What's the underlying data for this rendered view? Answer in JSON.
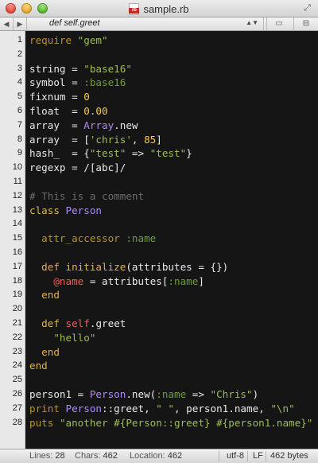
{
  "window": {
    "title": "sample.rb",
    "file_badge": "rb"
  },
  "symbol_bar": {
    "current_symbol": "def self.greet"
  },
  "editor": {
    "lines": [
      {
        "n": "1",
        "tokens": [
          [
            "req",
            "require"
          ],
          [
            "plain",
            " "
          ],
          [
            "str",
            "\"gem\""
          ]
        ]
      },
      {
        "n": "2",
        "tokens": []
      },
      {
        "n": "3",
        "tokens": [
          [
            "plain",
            "string = "
          ],
          [
            "str",
            "\"base16\""
          ]
        ]
      },
      {
        "n": "4",
        "tokens": [
          [
            "plain",
            "symbol = "
          ],
          [
            "sym",
            ":base16"
          ]
        ]
      },
      {
        "n": "5",
        "tokens": [
          [
            "plain",
            "fixnum = "
          ],
          [
            "num",
            "0"
          ]
        ]
      },
      {
        "n": "6",
        "tokens": [
          [
            "plain",
            "float  = "
          ],
          [
            "num",
            "0.00"
          ]
        ]
      },
      {
        "n": "7",
        "tokens": [
          [
            "plain",
            "array  = "
          ],
          [
            "const",
            "Array"
          ],
          [
            "plain",
            ".new"
          ]
        ]
      },
      {
        "n": "8",
        "tokens": [
          [
            "plain",
            "array  = ["
          ],
          [
            "str",
            "'chris'"
          ],
          [
            "plain",
            ", "
          ],
          [
            "num",
            "85"
          ],
          [
            "plain",
            "]"
          ]
        ]
      },
      {
        "n": "9",
        "tokens": [
          [
            "plain",
            "hash_  = {"
          ],
          [
            "str",
            "\"test\""
          ],
          [
            "plain",
            " => "
          ],
          [
            "str",
            "\"test\""
          ],
          [
            "plain",
            "}"
          ]
        ]
      },
      {
        "n": "10",
        "tokens": [
          [
            "plain",
            "regexp = /[abc]/"
          ]
        ]
      },
      {
        "n": "11",
        "tokens": []
      },
      {
        "n": "12",
        "tokens": [
          [
            "cmt",
            "# This is a comment"
          ]
        ]
      },
      {
        "n": "13",
        "tokens": [
          [
            "kw",
            "class"
          ],
          [
            "plain",
            " "
          ],
          [
            "const",
            "Person"
          ]
        ]
      },
      {
        "n": "14",
        "tokens": []
      },
      {
        "n": "15",
        "tokens": [
          [
            "plain",
            "  "
          ],
          [
            "req",
            "attr_accessor"
          ],
          [
            "plain",
            " "
          ],
          [
            "sym",
            ":name"
          ]
        ]
      },
      {
        "n": "16",
        "tokens": []
      },
      {
        "n": "17",
        "tokens": [
          [
            "plain",
            "  "
          ],
          [
            "kw",
            "def"
          ],
          [
            "plain",
            " "
          ],
          [
            "kw",
            "initialize"
          ],
          [
            "plain",
            "(attributes = {})"
          ]
        ]
      },
      {
        "n": "18",
        "tokens": [
          [
            "plain",
            "    "
          ],
          [
            "ivar",
            "@name"
          ],
          [
            "plain",
            " = attributes["
          ],
          [
            "sym",
            ":name"
          ],
          [
            "plain",
            "]"
          ]
        ]
      },
      {
        "n": "19",
        "tokens": [
          [
            "plain",
            "  "
          ],
          [
            "kw",
            "end"
          ]
        ]
      },
      {
        "n": "20",
        "tokens": []
      },
      {
        "n": "21",
        "tokens": [
          [
            "plain",
            "  "
          ],
          [
            "kw",
            "def"
          ],
          [
            "plain",
            " "
          ],
          [
            "ivar",
            "self"
          ],
          [
            "plain",
            ".greet"
          ]
        ]
      },
      {
        "n": "22",
        "tokens": [
          [
            "plain",
            "    "
          ],
          [
            "str",
            "\"hello\""
          ]
        ]
      },
      {
        "n": "23",
        "tokens": [
          [
            "plain",
            "  "
          ],
          [
            "kw",
            "end"
          ]
        ]
      },
      {
        "n": "24",
        "tokens": [
          [
            "kw",
            "end"
          ]
        ]
      },
      {
        "n": "25",
        "tokens": []
      },
      {
        "n": "26",
        "tokens": [
          [
            "plain",
            "person1 = "
          ],
          [
            "const",
            "Person"
          ],
          [
            "plain",
            ".new("
          ],
          [
            "sym",
            ":name"
          ],
          [
            "plain",
            " => "
          ],
          [
            "str",
            "\"Chris\""
          ],
          [
            "plain",
            ")"
          ]
        ]
      },
      {
        "n": "27",
        "tokens": [
          [
            "req",
            "print"
          ],
          [
            "plain",
            " "
          ],
          [
            "const",
            "Person"
          ],
          [
            "plain",
            "::greet, "
          ],
          [
            "str",
            "\" \""
          ],
          [
            "plain",
            ", person1.name, "
          ],
          [
            "str",
            "\"\\n\""
          ]
        ]
      },
      {
        "n": "28",
        "tokens": [
          [
            "req",
            "puts"
          ],
          [
            "plain",
            " "
          ],
          [
            "str",
            "\"another #{Person::greet} #{person1.name}\""
          ]
        ]
      }
    ]
  },
  "status_bar": {
    "lines_label": "Lines:",
    "lines_value": "28",
    "chars_label": "Chars:",
    "chars_value": "462",
    "location_label": "Location:",
    "location_value": "462",
    "encoding": "utf-8",
    "line_ending": "LF",
    "size": "462 bytes"
  },
  "colors": {
    "background": "#151515",
    "gutter": "#e8e8e8",
    "keyword": "#e3b24b",
    "string": "#9cbd52",
    "symbol": "#6f9d3c",
    "number": "#fbc94f",
    "constant": "#ae8bf3",
    "comment": "#6b6b6b",
    "ivar": "#e0635a"
  }
}
